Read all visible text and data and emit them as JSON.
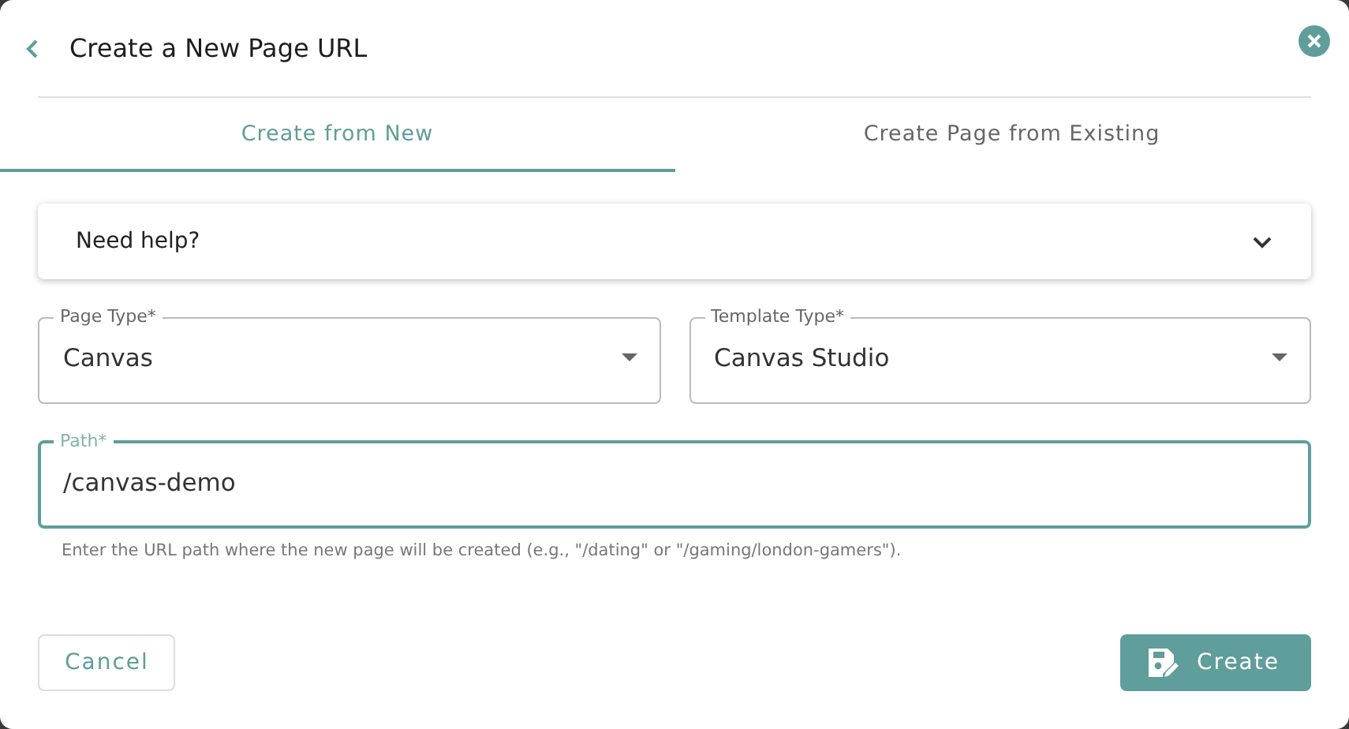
{
  "dialog": {
    "title": "Create a New Page URL"
  },
  "tabs": [
    {
      "label": "Create from New",
      "selected": true
    },
    {
      "label": "Create Page from Existing",
      "selected": false
    }
  ],
  "help": {
    "label": "Need help?",
    "expanded": false
  },
  "fields": [
    {
      "kind": "select",
      "label": "Page Type*",
      "value": "Canvas",
      "focused": false
    },
    {
      "kind": "select",
      "label": "Template Type*",
      "value": "Canvas Studio",
      "focused": false
    },
    {
      "kind": "text",
      "label": "Path*",
      "value": "/canvas-demo",
      "focused": true,
      "helper": "Enter the URL path where the new page will be created (e.g., \"/dating\" or \"/gaming/london-gamers\")."
    }
  ],
  "buttons": [
    {
      "kind": "secondary",
      "label": "Cancel"
    },
    {
      "kind": "primary",
      "label": "Create"
    }
  ]
}
